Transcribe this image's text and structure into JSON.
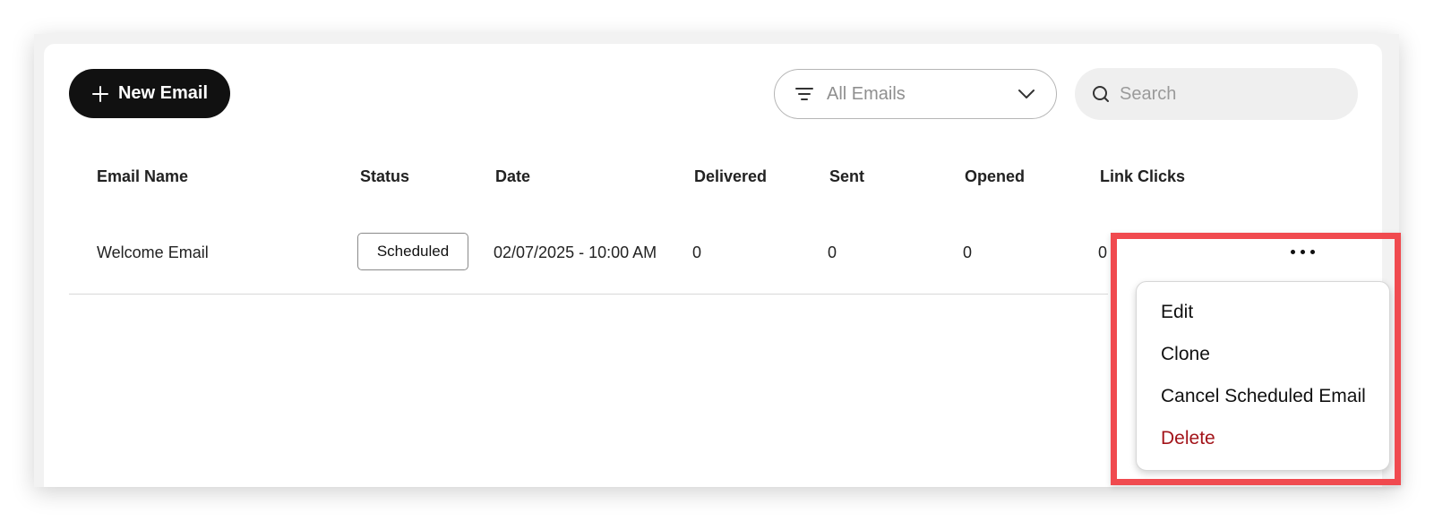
{
  "toolbar": {
    "new_email_label": "New Email",
    "filter_value": "All Emails",
    "search_placeholder": "Search"
  },
  "table": {
    "columns": [
      "Email Name",
      "Status",
      "Date",
      "Delivered",
      "Sent",
      "Opened",
      "Link Clicks"
    ],
    "rows": [
      {
        "email_name": "Welcome Email",
        "status": "Scheduled",
        "date": "02/07/2025 - 10:00 AM",
        "delivered": "0",
        "sent": "0",
        "opened": "0",
        "link_clicks": "0"
      }
    ]
  },
  "row_menu": {
    "items": [
      "Edit",
      "Clone",
      "Cancel Scheduled Email",
      "Delete"
    ]
  },
  "colors": {
    "primary_button": "#111111",
    "danger_text": "#a3141a",
    "highlight": "#f04a4f"
  },
  "icons": [
    "plus-icon",
    "filter-icon",
    "chevron-down-icon",
    "search-icon",
    "more-horizontal-icon"
  ]
}
